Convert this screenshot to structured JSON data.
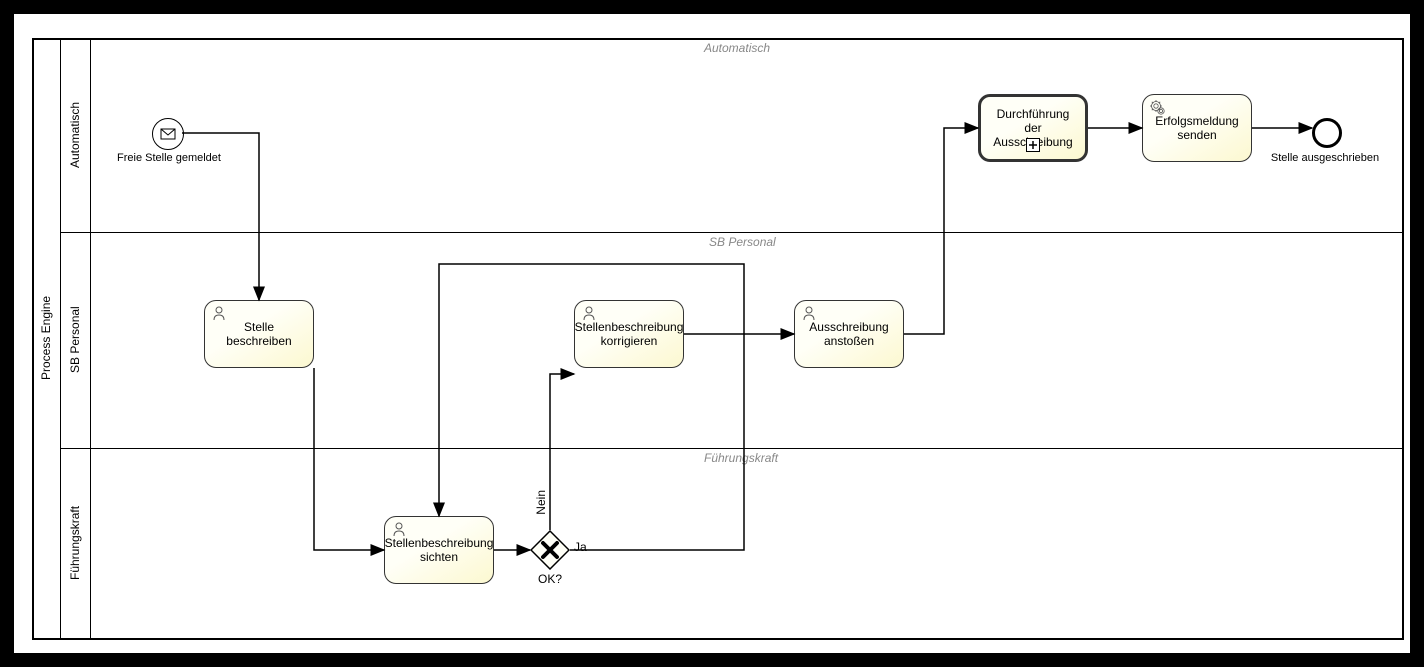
{
  "pool": {
    "label": "Process Engine"
  },
  "lanes": {
    "auto": {
      "label": "Automatisch",
      "header": "Automatisch"
    },
    "sb": {
      "label": "SB Personal",
      "header": "SB Personal"
    },
    "fk": {
      "label": "Führungskraft",
      "header": "Führungskraft"
    }
  },
  "events": {
    "start": {
      "label": "Freie Stelle gemeldet"
    },
    "end": {
      "label": "Stelle ausgeschrieben"
    }
  },
  "tasks": {
    "t1": {
      "label": "Stelle beschreiben"
    },
    "t2": {
      "label": "Stellenbeschreibung sichten"
    },
    "t3": {
      "label": "Stellenbeschreibung korrigieren"
    },
    "t4": {
      "label": "Ausschreibung anstoßen"
    },
    "t5": {
      "label": "Durchführung der Ausschreibung"
    },
    "t6": {
      "label": "Erfolgsmeldung senden"
    }
  },
  "gateway": {
    "g1": {
      "label": "OK?",
      "yes": "Ja",
      "no": "Nein"
    }
  }
}
